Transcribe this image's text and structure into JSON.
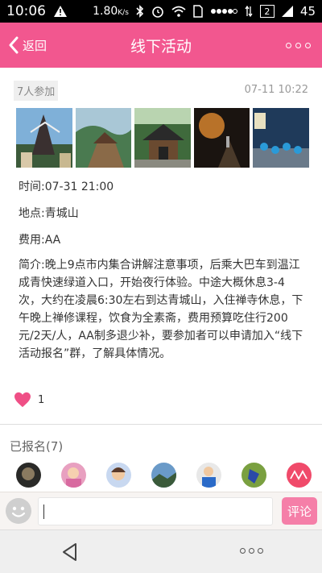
{
  "status_bar": {
    "time": "10:06",
    "speed": "1.80",
    "speed_unit": "K/s",
    "sim_label": "2",
    "battery": "45"
  },
  "header": {
    "back_label": "返回",
    "title": "线下活动"
  },
  "activity": {
    "participants": "7人参加",
    "posted_time": "07-11 10:22",
    "time_line": "时间:07-31 21:00",
    "place_line": "地点:青城山",
    "fee_line": "费用:AA",
    "intro": "简介:晚上9点市内集合讲解注意事项，后乘大巴车到温江成青快速绿道入口，开始夜行体验。中途大概休息3-4次，大约在凌晨6:30左右到达青城山，入住禅寺休息，下午晚上禅修课程，饮食为全素斋，费用预算吃住行200元/2天/人，AA制多退少补，要参加者可以申请加入“线下活动报名”群，了解具体情况。",
    "like_count": "1"
  },
  "registered": {
    "label": "已报名(7)"
  },
  "comment": {
    "placeholder": "",
    "button_label": "评论"
  },
  "colors": {
    "accent": "#f2578f",
    "button": "#f57fa8",
    "heart": "#ef4f86"
  }
}
